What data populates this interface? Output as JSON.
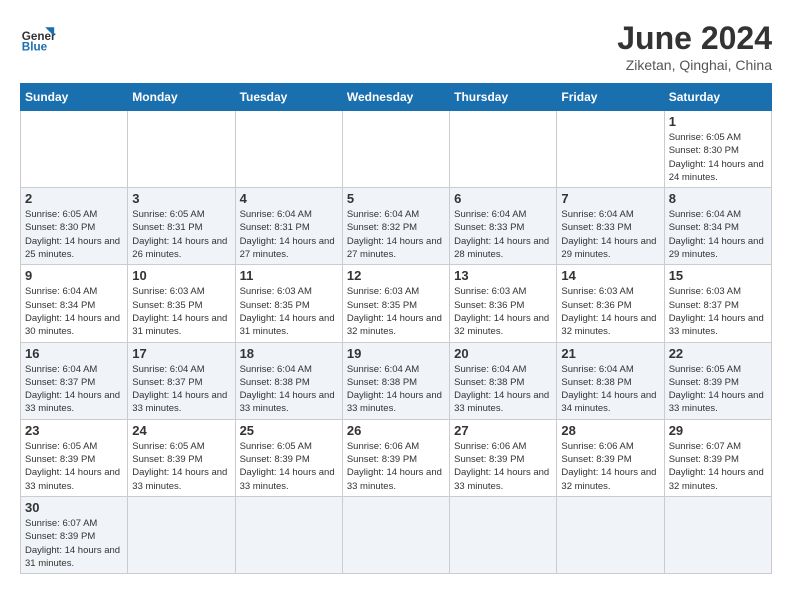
{
  "header": {
    "logo_general": "General",
    "logo_blue": "Blue",
    "title": "June 2024",
    "subtitle": "Ziketan, Qinghai, China"
  },
  "weekdays": [
    "Sunday",
    "Monday",
    "Tuesday",
    "Wednesday",
    "Thursday",
    "Friday",
    "Saturday"
  ],
  "weeks": [
    [
      {
        "day": "",
        "info": ""
      },
      {
        "day": "",
        "info": ""
      },
      {
        "day": "",
        "info": ""
      },
      {
        "day": "",
        "info": ""
      },
      {
        "day": "",
        "info": ""
      },
      {
        "day": "",
        "info": ""
      },
      {
        "day": "1",
        "info": "Sunrise: 6:05 AM\nSunset: 8:30 PM\nDaylight: 14 hours and 24 minutes."
      }
    ],
    [
      {
        "day": "2",
        "info": "Sunrise: 6:05 AM\nSunset: 8:30 PM\nDaylight: 14 hours and 25 minutes."
      },
      {
        "day": "3",
        "info": "Sunrise: 6:05 AM\nSunset: 8:31 PM\nDaylight: 14 hours and 26 minutes."
      },
      {
        "day": "4",
        "info": "Sunrise: 6:04 AM\nSunset: 8:31 PM\nDaylight: 14 hours and 27 minutes."
      },
      {
        "day": "5",
        "info": "Sunrise: 6:04 AM\nSunset: 8:32 PM\nDaylight: 14 hours and 27 minutes."
      },
      {
        "day": "6",
        "info": "Sunrise: 6:04 AM\nSunset: 8:33 PM\nDaylight: 14 hours and 28 minutes."
      },
      {
        "day": "7",
        "info": "Sunrise: 6:04 AM\nSunset: 8:33 PM\nDaylight: 14 hours and 29 minutes."
      },
      {
        "day": "8",
        "info": "Sunrise: 6:04 AM\nSunset: 8:34 PM\nDaylight: 14 hours and 29 minutes."
      }
    ],
    [
      {
        "day": "9",
        "info": "Sunrise: 6:04 AM\nSunset: 8:34 PM\nDaylight: 14 hours and 30 minutes."
      },
      {
        "day": "10",
        "info": "Sunrise: 6:03 AM\nSunset: 8:35 PM\nDaylight: 14 hours and 31 minutes."
      },
      {
        "day": "11",
        "info": "Sunrise: 6:03 AM\nSunset: 8:35 PM\nDaylight: 14 hours and 31 minutes."
      },
      {
        "day": "12",
        "info": "Sunrise: 6:03 AM\nSunset: 8:35 PM\nDaylight: 14 hours and 32 minutes."
      },
      {
        "day": "13",
        "info": "Sunrise: 6:03 AM\nSunset: 8:36 PM\nDaylight: 14 hours and 32 minutes."
      },
      {
        "day": "14",
        "info": "Sunrise: 6:03 AM\nSunset: 8:36 PM\nDaylight: 14 hours and 32 minutes."
      },
      {
        "day": "15",
        "info": "Sunrise: 6:03 AM\nSunset: 8:37 PM\nDaylight: 14 hours and 33 minutes."
      }
    ],
    [
      {
        "day": "16",
        "info": "Sunrise: 6:04 AM\nSunset: 8:37 PM\nDaylight: 14 hours and 33 minutes."
      },
      {
        "day": "17",
        "info": "Sunrise: 6:04 AM\nSunset: 8:37 PM\nDaylight: 14 hours and 33 minutes."
      },
      {
        "day": "18",
        "info": "Sunrise: 6:04 AM\nSunset: 8:38 PM\nDaylight: 14 hours and 33 minutes."
      },
      {
        "day": "19",
        "info": "Sunrise: 6:04 AM\nSunset: 8:38 PM\nDaylight: 14 hours and 33 minutes."
      },
      {
        "day": "20",
        "info": "Sunrise: 6:04 AM\nSunset: 8:38 PM\nDaylight: 14 hours and 33 minutes."
      },
      {
        "day": "21",
        "info": "Sunrise: 6:04 AM\nSunset: 8:38 PM\nDaylight: 14 hours and 34 minutes."
      },
      {
        "day": "22",
        "info": "Sunrise: 6:05 AM\nSunset: 8:39 PM\nDaylight: 14 hours and 33 minutes."
      }
    ],
    [
      {
        "day": "23",
        "info": "Sunrise: 6:05 AM\nSunset: 8:39 PM\nDaylight: 14 hours and 33 minutes."
      },
      {
        "day": "24",
        "info": "Sunrise: 6:05 AM\nSunset: 8:39 PM\nDaylight: 14 hours and 33 minutes."
      },
      {
        "day": "25",
        "info": "Sunrise: 6:05 AM\nSunset: 8:39 PM\nDaylight: 14 hours and 33 minutes."
      },
      {
        "day": "26",
        "info": "Sunrise: 6:06 AM\nSunset: 8:39 PM\nDaylight: 14 hours and 33 minutes."
      },
      {
        "day": "27",
        "info": "Sunrise: 6:06 AM\nSunset: 8:39 PM\nDaylight: 14 hours and 33 minutes."
      },
      {
        "day": "28",
        "info": "Sunrise: 6:06 AM\nSunset: 8:39 PM\nDaylight: 14 hours and 32 minutes."
      },
      {
        "day": "29",
        "info": "Sunrise: 6:07 AM\nSunset: 8:39 PM\nDaylight: 14 hours and 32 minutes."
      }
    ],
    [
      {
        "day": "30",
        "info": "Sunrise: 6:07 AM\nSunset: 8:39 PM\nDaylight: 14 hours and 31 minutes."
      },
      {
        "day": "",
        "info": ""
      },
      {
        "day": "",
        "info": ""
      },
      {
        "day": "",
        "info": ""
      },
      {
        "day": "",
        "info": ""
      },
      {
        "day": "",
        "info": ""
      },
      {
        "day": "",
        "info": ""
      }
    ]
  ]
}
